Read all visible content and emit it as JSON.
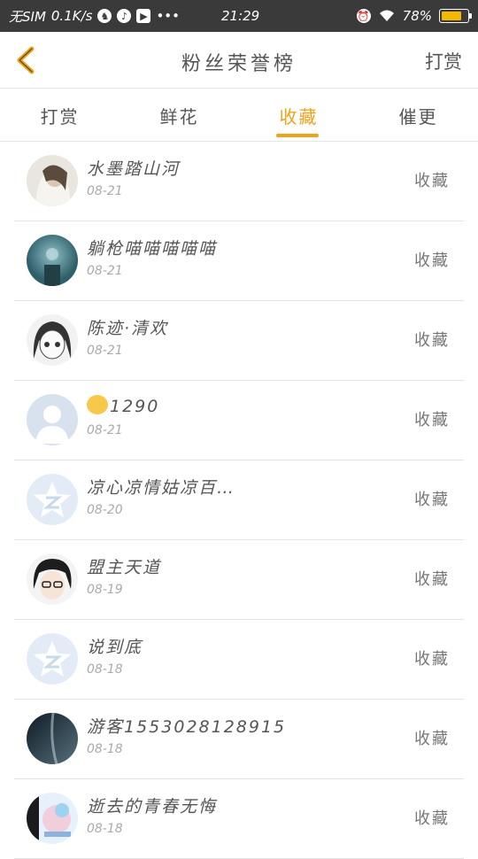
{
  "status_bar": {
    "carrier": "无SIM",
    "speed": "0.1K/s",
    "time": "21:29",
    "battery_text": "78%",
    "battery_level": 0.78
  },
  "header": {
    "title": "粉丝荣誉榜",
    "right_action": "打赏"
  },
  "tabs": [
    {
      "label": "打赏"
    },
    {
      "label": "鲜花"
    },
    {
      "label": "收藏"
    },
    {
      "label": "催更"
    }
  ],
  "active_tab": 2,
  "colors": {
    "accent": "#f0a11a"
  },
  "rows": [
    {
      "name": "水墨踏山河",
      "date": "08-21",
      "action": "收藏",
      "avatar": "portrait-light"
    },
    {
      "name": "躺枪喵喵喵喵喵",
      "date": "08-21",
      "action": "收藏",
      "avatar": "teal-night"
    },
    {
      "name": "陈迹·清欢",
      "date": "08-21",
      "action": "收藏",
      "avatar": "anime-sketch"
    },
    {
      "name": "1290",
      "date": "08-21",
      "action": "收藏",
      "avatar": "default-person",
      "emoji": true
    },
    {
      "name": "凉心凉情姑凉百…",
      "date": "08-20",
      "action": "收藏",
      "avatar": "qzone-star"
    },
    {
      "name": "盟主天道",
      "date": "08-19",
      "action": "收藏",
      "avatar": "anime-boy"
    },
    {
      "name": "说到底",
      "date": "08-18",
      "action": "收藏",
      "avatar": "qzone-star"
    },
    {
      "name": "游客1553028128915",
      "date": "08-18",
      "action": "收藏",
      "avatar": "dark-galaxy"
    },
    {
      "name": "逝去的青春无悔",
      "date": "08-18",
      "action": "收藏",
      "avatar": "colorful-art"
    }
  ]
}
